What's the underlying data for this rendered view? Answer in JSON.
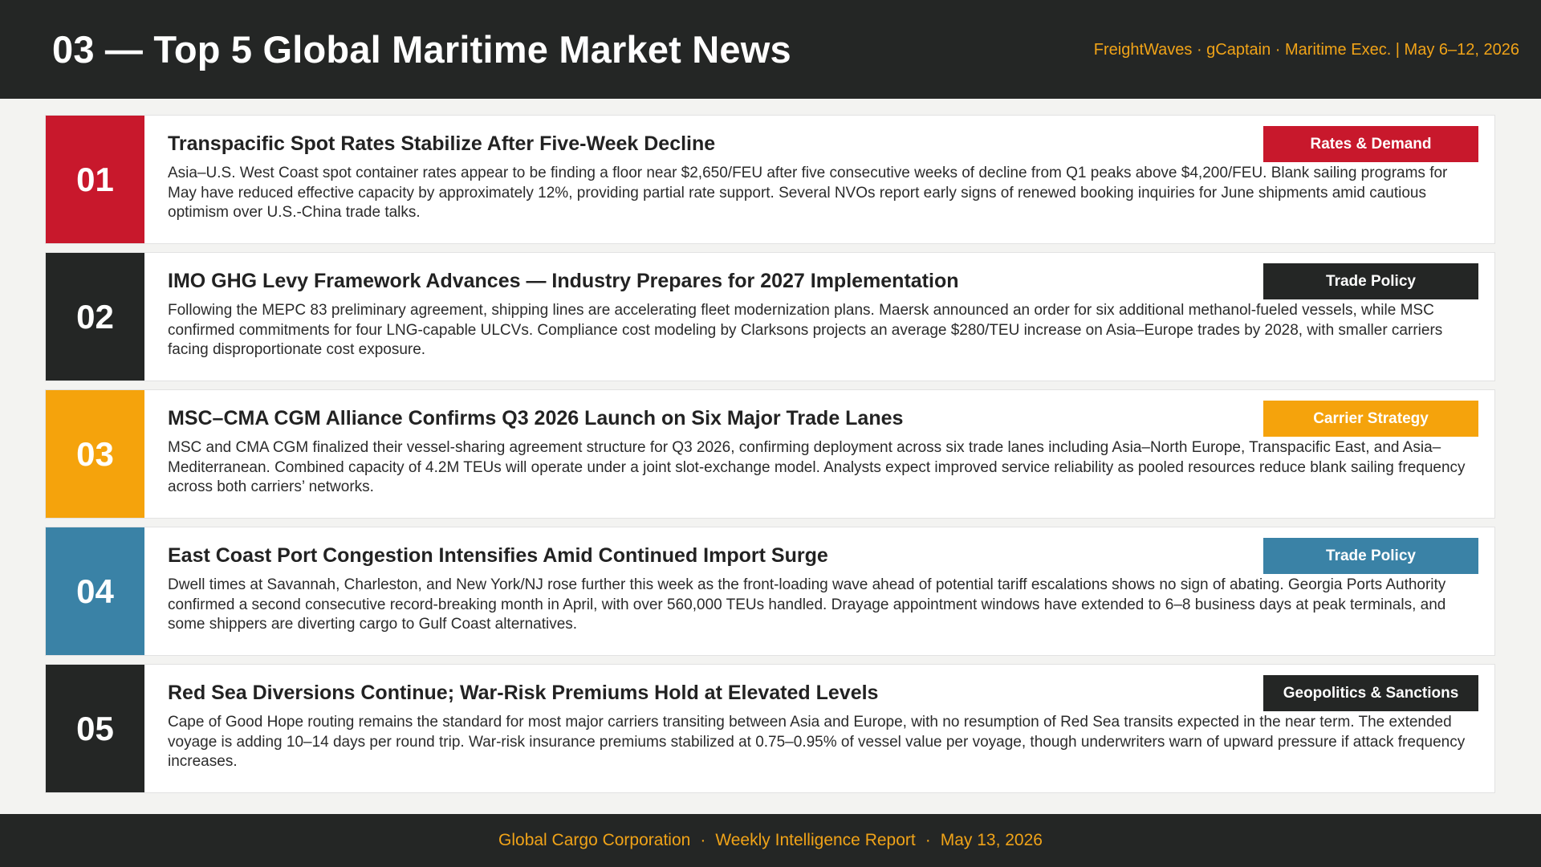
{
  "header": {
    "title": "03 — Top 5 Global Maritime Market News",
    "meta": "FreightWaves · gCaptain · Maritime Exec.  |  May 6–12, 2026"
  },
  "colors": {
    "red": "#c8182c",
    "dark": "#242625",
    "amber": "#f5a30c",
    "steel_blue": "#3a82a6"
  },
  "news": [
    {
      "number": "01",
      "color": "#c8182c",
      "title": "Transpacific Spot Rates Stabilize After Five-Week Decline",
      "tag": "Rates & Demand",
      "tag_color": "#c8182c",
      "body": "Asia–U.S. West Coast spot container rates appear to be finding a floor near $2,650/FEU after five consecutive weeks of decline from Q1 peaks above $4,200/FEU. Blank sailing programs for May have reduced effective capacity by approximately 12%, providing partial rate support. Several NVOs report early signs of renewed booking inquiries for June shipments amid cautious optimism over U.S.-China trade talks."
    },
    {
      "number": "02",
      "color": "#242625",
      "title": "IMO GHG Levy Framework Advances — Industry Prepares for 2027 Implementation",
      "tag": "Trade Policy",
      "tag_color": "#242625",
      "body": "Following the MEPC 83 preliminary agreement, shipping lines are accelerating fleet modernization plans. Maersk announced an order for six additional methanol-fueled vessels, while MSC confirmed commitments for four LNG-capable ULCVs. Compliance cost modeling by Clarksons projects an average $280/TEU increase on Asia–Europe trades by 2028, with smaller carriers facing disproportionate cost exposure."
    },
    {
      "number": "03",
      "color": "#f5a30c",
      "title": "MSC–CMA CGM Alliance Confirms Q3 2026 Launch on Six Major Trade Lanes",
      "tag": "Carrier Strategy",
      "tag_color": "#f5a30c",
      "body": "MSC and CMA CGM finalized their vessel-sharing agreement structure for Q3 2026, confirming deployment across six trade lanes including Asia–North Europe, Transpacific East, and Asia–Mediterranean. Combined capacity of 4.2M TEUs will operate under a joint slot-exchange model. Analysts expect improved service reliability as pooled resources reduce blank sailing frequency across both carriers’ networks."
    },
    {
      "number": "04",
      "color": "#3a82a6",
      "title": "East Coast Port Congestion Intensifies Amid Continued Import Surge",
      "tag": "Trade Policy",
      "tag_color": "#3a82a6",
      "body": "Dwell times at Savannah, Charleston, and New York/NJ rose further this week as the front-loading wave ahead of potential tariff escalations shows no sign of abating. Georgia Ports Authority confirmed a second consecutive record-breaking month in April, with over 560,000 TEUs handled. Drayage appointment windows have extended to 6–8 business days at peak terminals, and some shippers are diverting cargo to Gulf Coast alternatives."
    },
    {
      "number": "05",
      "color": "#242625",
      "title": "Red Sea Diversions Continue; War-Risk Premiums Hold at Elevated Levels",
      "tag": "Geopolitics & Sanctions",
      "tag_color": "#242625",
      "body": "Cape of Good Hope routing remains the standard for most major carriers transiting between Asia and Europe, with no resumption of Red Sea transits expected in the near term. The extended voyage is adding 10–14 days per round trip. War-risk insurance premiums stabilized at 0.75–0.95% of vessel value per voyage, though underwriters warn of upward pressure if attack frequency increases."
    }
  ],
  "footer": {
    "company": "Global Cargo Corporation",
    "report": "Weekly Intelligence Report",
    "date": "May 13, 2026",
    "separator": "·"
  }
}
